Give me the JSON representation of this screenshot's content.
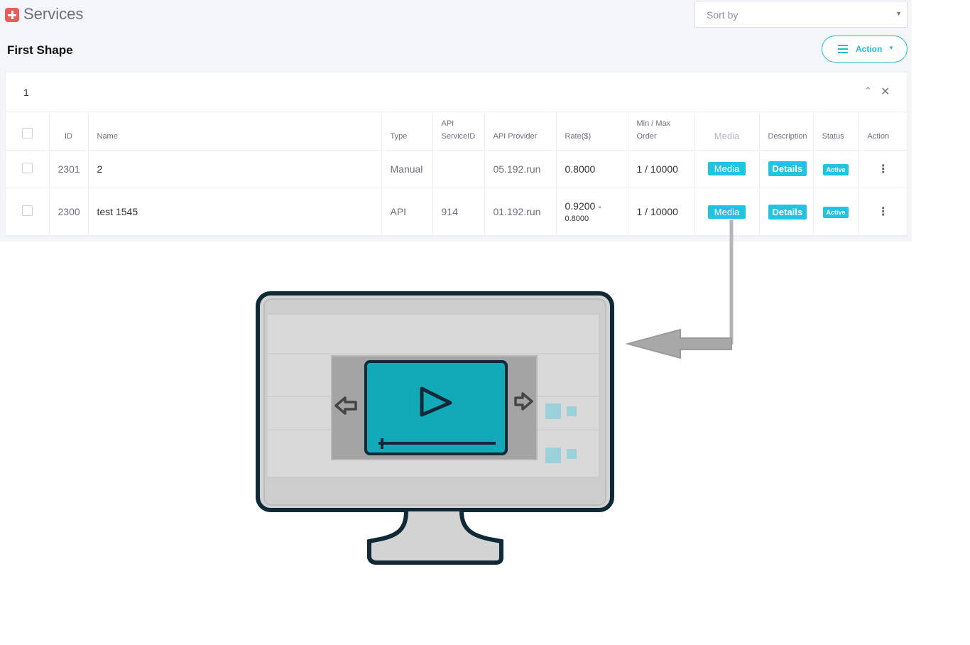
{
  "header": {
    "title": "Services",
    "sort_placeholder": "Sort by",
    "subtitle": "First Shape",
    "action_label": "Action"
  },
  "card": {
    "title": "1"
  },
  "table": {
    "columns": [
      "ID",
      "Name",
      "Type",
      "API ServiceID",
      "API Provider",
      "Rate($)",
      "Min / Max Order",
      "Media",
      "Description",
      "Status",
      "Action"
    ],
    "col_api_line1": "API",
    "col_api_line2": "ServiceID",
    "col_minmax_line1": "Min / Max",
    "col_minmax_line2": "Order",
    "rows": [
      {
        "id": "2301",
        "name": "2",
        "type": "Manual",
        "api_service_id": "",
        "provider": "05.192.run",
        "rate": "0.8000",
        "rate_sub": "",
        "minmax": "1 / 10000",
        "media": "Media",
        "details": "Details",
        "status": "Active"
      },
      {
        "id": "2300",
        "name": "test 1545",
        "type": "API",
        "api_service_id": "914",
        "provider": "01.192.run",
        "rate": "0.9200 -",
        "rate_sub": "0.8000",
        "minmax": "1 / 10000",
        "media": "Media",
        "details": "Details",
        "status": "Active"
      }
    ]
  },
  "illustration": {
    "icons": [
      "monitor-icon",
      "video-player-icon",
      "play-icon",
      "arrow-left-icon",
      "arrow-right-icon"
    ],
    "colors": {
      "monitor_frame": "#0f2a36",
      "video_screen": "#12a9b9",
      "arrow": "#a8a8a8"
    }
  }
}
